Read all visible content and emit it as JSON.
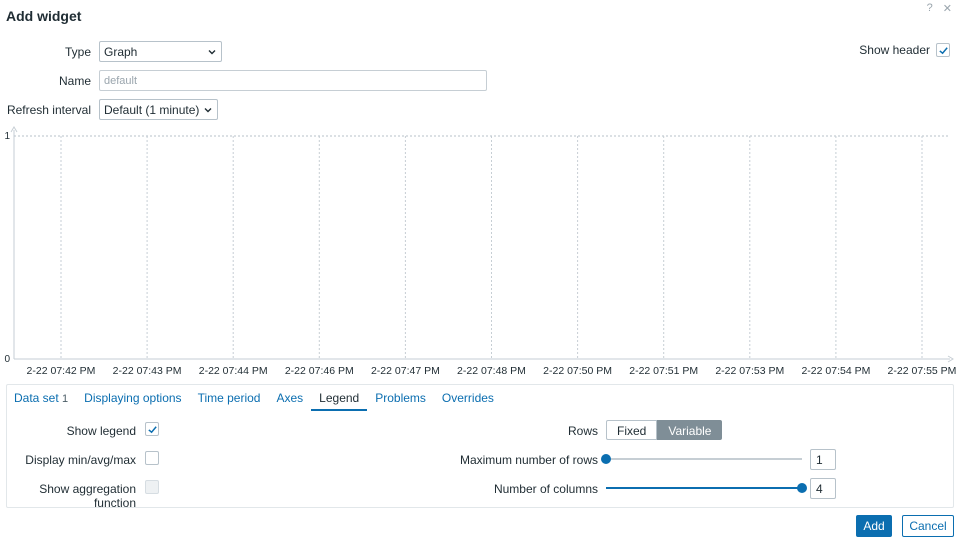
{
  "dialog": {
    "title": "Add widget",
    "help_icon": "?",
    "close_icon": "✕"
  },
  "form": {
    "type_label": "Type",
    "type_value": "Graph",
    "name_label": "Name",
    "name_placeholder": "default",
    "refresh_label": "Refresh interval",
    "refresh_value": "Default (1 minute)",
    "show_header_label": "Show header",
    "show_header_checked": true
  },
  "chart_data": {
    "type": "line",
    "title": "",
    "xlabel": "",
    "ylabel": "",
    "ylim": [
      0,
      1
    ],
    "y_ticks": [
      "1",
      "0"
    ],
    "x_ticks": [
      "2-22 07:42 PM",
      "2-22 07:43 PM",
      "2-22 07:44 PM",
      "2-22 07:46 PM",
      "2-22 07:47 PM",
      "2-22 07:48 PM",
      "2-22 07:50 PM",
      "2-22 07:51 PM",
      "2-22 07:53 PM",
      "2-22 07:54 PM",
      "2-22 07:55 PM"
    ],
    "series": [],
    "grid": true
  },
  "tabs": [
    {
      "label": "Data set",
      "count": "1"
    },
    {
      "label": "Displaying options"
    },
    {
      "label": "Time period"
    },
    {
      "label": "Axes"
    },
    {
      "label": "Legend"
    },
    {
      "label": "Problems"
    },
    {
      "label": "Overrides"
    }
  ],
  "legend": {
    "show_legend_label": "Show legend",
    "show_legend_checked": true,
    "minavgmax_label": "Display min/avg/max",
    "minavgmax_checked": false,
    "aggregation_label": "Show aggregation function",
    "aggregation_checked": false,
    "rows_label": "Rows",
    "rows_options": [
      "Fixed",
      "Variable"
    ],
    "rows_selected": "Variable",
    "max_rows_label": "Maximum number of rows",
    "max_rows_value": "1",
    "max_rows_level": 0,
    "num_columns_label": "Number of columns",
    "num_columns_value": "4",
    "num_columns_level": 1
  },
  "footer": {
    "add_label": "Add",
    "cancel_label": "Cancel"
  },
  "colors": {
    "accent": "#0b6eb0",
    "grid": "#b7c2ca",
    "segment_selected": "#7f8e97"
  }
}
